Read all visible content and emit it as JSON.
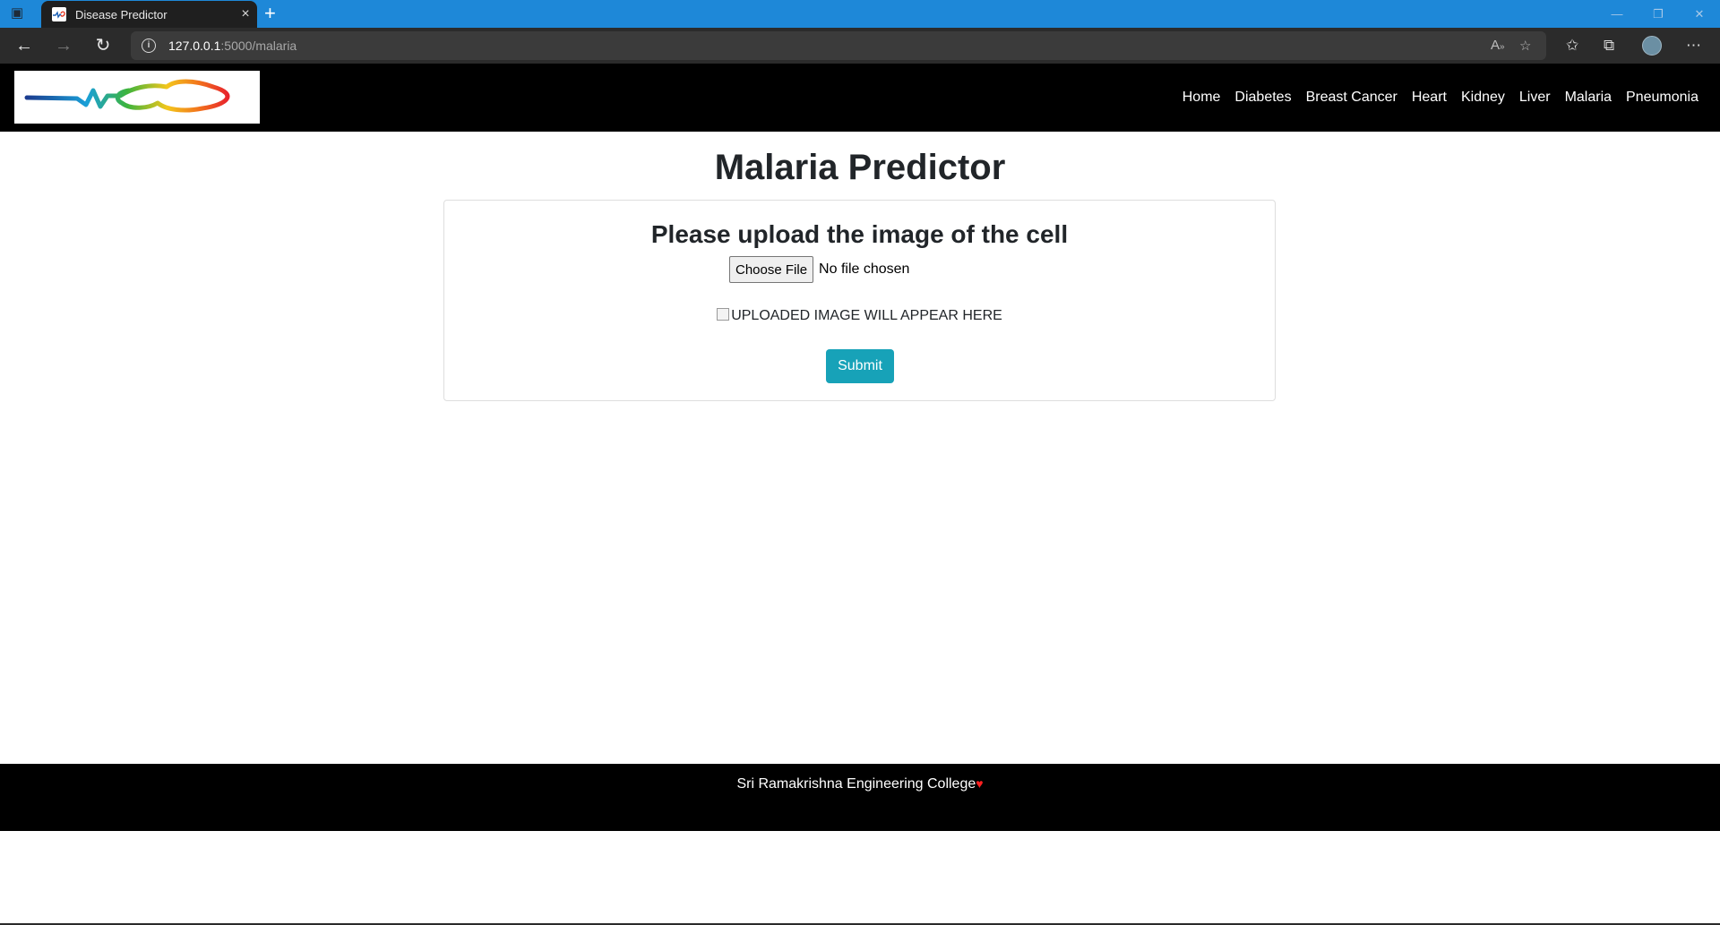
{
  "browser": {
    "tab_title": "Disease Predictor",
    "tab_close": "×",
    "new_tab": "+",
    "url_host": "127.0.0.1",
    "url_path": ":5000/malaria",
    "window_minimize": "—",
    "window_restore": "❐",
    "window_close": "✕",
    "icons": [
      "tab-actions-icon",
      "back-icon",
      "forward-icon",
      "refresh-icon",
      "info-icon",
      "read-aloud-icon",
      "add-favorite-icon",
      "favorites-icon",
      "collections-icon",
      "profile-icon",
      "more-icon"
    ]
  },
  "site": {
    "nav": [
      "Home",
      "Diabetes",
      "Breast Cancer",
      "Heart",
      "Kidney",
      "Liver",
      "Malaria",
      "Pneumonia"
    ]
  },
  "main": {
    "title": "Malaria Predictor",
    "card_heading": "Please upload the image of the cell",
    "file_button": "Choose File",
    "file_status": "No file chosen",
    "image_alt": "UPLOADED IMAGE WILL APPEAR HERE",
    "submit": "Submit"
  },
  "footer": {
    "text": "Sri Ramakrishna Engineering College",
    "heart": "♥"
  },
  "colors": {
    "tabbar": "#1e88d8",
    "navbar": "#000000",
    "submit": "#17a2b8",
    "heart": "#ff2020"
  }
}
